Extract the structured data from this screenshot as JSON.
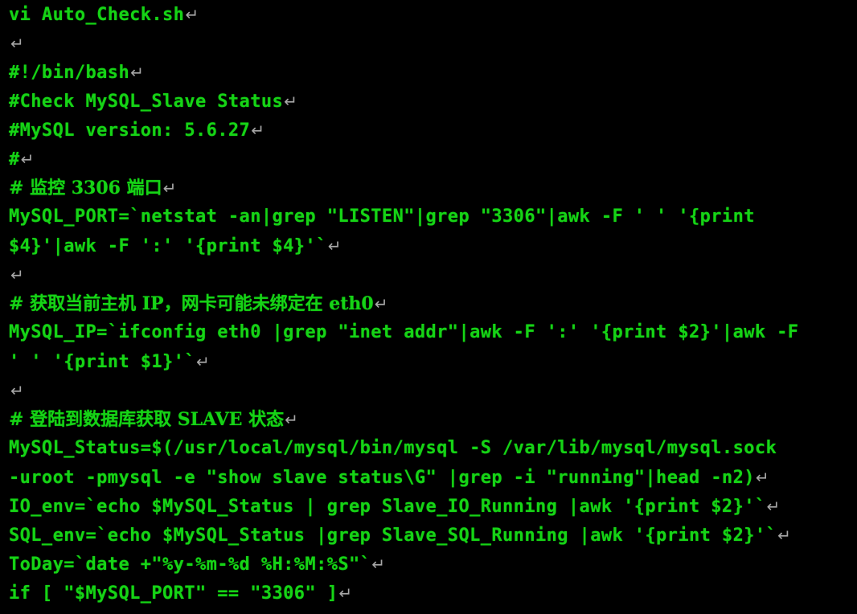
{
  "terminal": {
    "app": "vi",
    "colors": {
      "background": "#000000",
      "foreground": "#16d316",
      "eol_mark": "#a6a6a6"
    },
    "eol_glyph": "↵",
    "lines": [
      {
        "id": "line-1",
        "text": "vi Auto_Check.sh",
        "cjk": false,
        "eol": true
      },
      {
        "id": "line-2",
        "text": "",
        "cjk": false,
        "eol": true
      },
      {
        "id": "line-3",
        "text": "#!/bin/bash",
        "cjk": false,
        "eol": true
      },
      {
        "id": "line-4",
        "text": "#Check MySQL_Slave Status",
        "cjk": false,
        "eol": true
      },
      {
        "id": "line-5",
        "text": "#MySQL version: 5.6.27",
        "cjk": false,
        "eol": true
      },
      {
        "id": "line-6",
        "text": "#",
        "cjk": false,
        "eol": true
      },
      {
        "id": "line-7",
        "text": "# 监控 3306 端口",
        "cjk": true,
        "eol": true
      },
      {
        "id": "line-8",
        "text": "MySQL_PORT=`netstat -an|grep \"LISTEN\"|grep \"3306\"|awk -F ' ' '{print",
        "cjk": false,
        "eol": false
      },
      {
        "id": "line-9",
        "text": "$4}'|awk -F ':' '{print $4}'`",
        "cjk": false,
        "eol": true
      },
      {
        "id": "line-10",
        "text": "",
        "cjk": false,
        "eol": true
      },
      {
        "id": "line-11",
        "text": "# 获取当前主机 IP，网卡可能未绑定在 eth0",
        "cjk": true,
        "eol": true
      },
      {
        "id": "line-12",
        "text": "MySQL_IP=`ifconfig eth0 |grep \"inet addr\"|awk -F ':' '{print $2}'|awk -F",
        "cjk": false,
        "eol": false
      },
      {
        "id": "line-13",
        "text": "' ' '{print $1}'`",
        "cjk": false,
        "eol": true
      },
      {
        "id": "line-14",
        "text": "",
        "cjk": false,
        "eol": true
      },
      {
        "id": "line-15",
        "text": "# 登陆到数据库获取 SLAVE 状态",
        "cjk": true,
        "eol": true
      },
      {
        "id": "line-16",
        "text": "MySQL_Status=$(/usr/local/mysql/bin/mysql -S /var/lib/mysql/mysql.sock",
        "cjk": false,
        "eol": false
      },
      {
        "id": "line-17",
        "text": "-uroot -pmysql -e \"show slave status\\G\" |grep -i \"running\"|head -n2)",
        "cjk": false,
        "eol": true
      },
      {
        "id": "line-18",
        "text": "IO_env=`echo $MySQL_Status | grep Slave_IO_Running |awk '{print $2}'`",
        "cjk": false,
        "eol": true
      },
      {
        "id": "line-19",
        "text": "SQL_env=`echo $MySQL_Status |grep Slave_SQL_Running |awk '{print $2}'`",
        "cjk": false,
        "eol": true
      },
      {
        "id": "line-20",
        "text": "ToDay=`date +\"%y-%m-%d %H:%M:%S\"`",
        "cjk": false,
        "eol": true
      },
      {
        "id": "line-21",
        "text": "if [ \"$MySQL_PORT\" == \"3306\" ]",
        "cjk": false,
        "eol": true
      }
    ]
  }
}
